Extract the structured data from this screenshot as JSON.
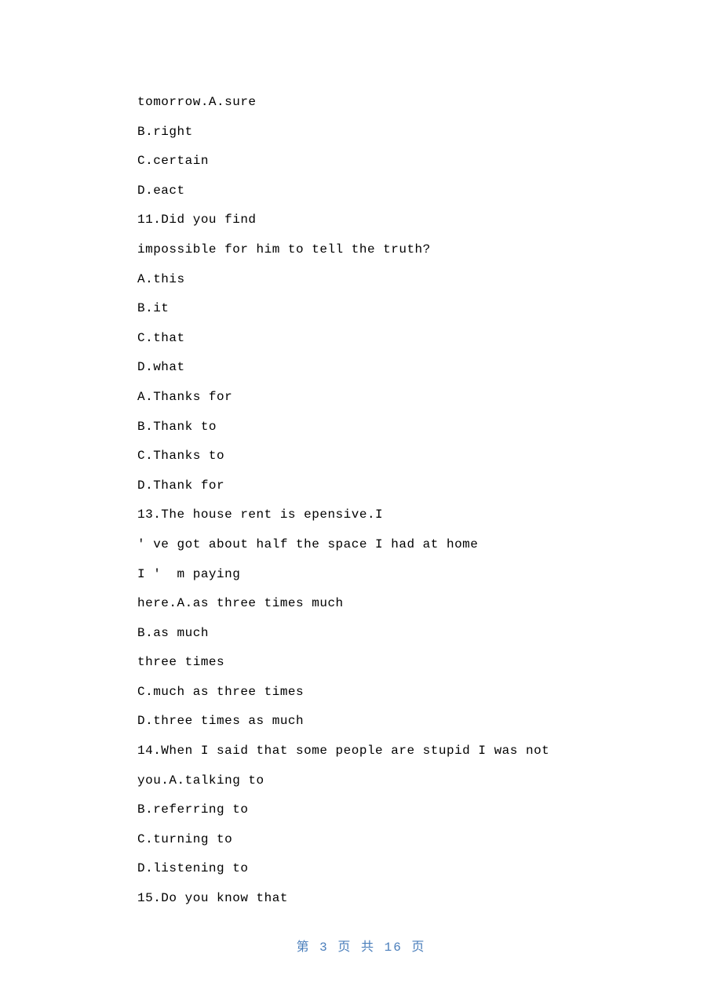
{
  "lines": [
    "tomorrow.A.sure",
    "B.right",
    "C.certain",
    "D.eact",
    "11.Did you find",
    "impossible for him to tell the truth?",
    "A.this",
    "B.it",
    "C.that",
    "D.what",
    "A.Thanks for",
    "B.Thank to",
    "C.Thanks to",
    "D.Thank for",
    "13.The house rent is epensive.I",
    "' ve got about half the space I had at home",
    "I '  m paying",
    "here.A.as three times much",
    "B.as much",
    "three times",
    "C.much as three times",
    "D.three times as much",
    "14.When I said that some people are stupid I was not",
    "you.A.talking to",
    "B.referring to",
    "C.turning to",
    "D.listening to",
    "15.Do you know that"
  ],
  "footer": "第 3 页 共 16 页"
}
